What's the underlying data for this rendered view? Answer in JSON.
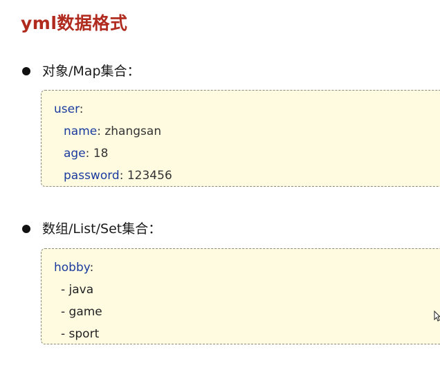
{
  "title": "yml数据格式",
  "sections": [
    {
      "heading": "对象/Map集合：",
      "root_key": "user",
      "fields": [
        {
          "key": "name",
          "value": "zhangsan"
        },
        {
          "key": "age",
          "value": "18"
        },
        {
          "key": "password",
          "value": "123456"
        }
      ]
    },
    {
      "heading": "数组/List/Set集合：",
      "root_key": "hobby",
      "items": [
        "- java",
        "- game",
        "- sport"
      ]
    }
  ],
  "colors": {
    "title": "#b02a1e",
    "key": "#1a3b9e",
    "box_bg": "#fffbe1"
  }
}
